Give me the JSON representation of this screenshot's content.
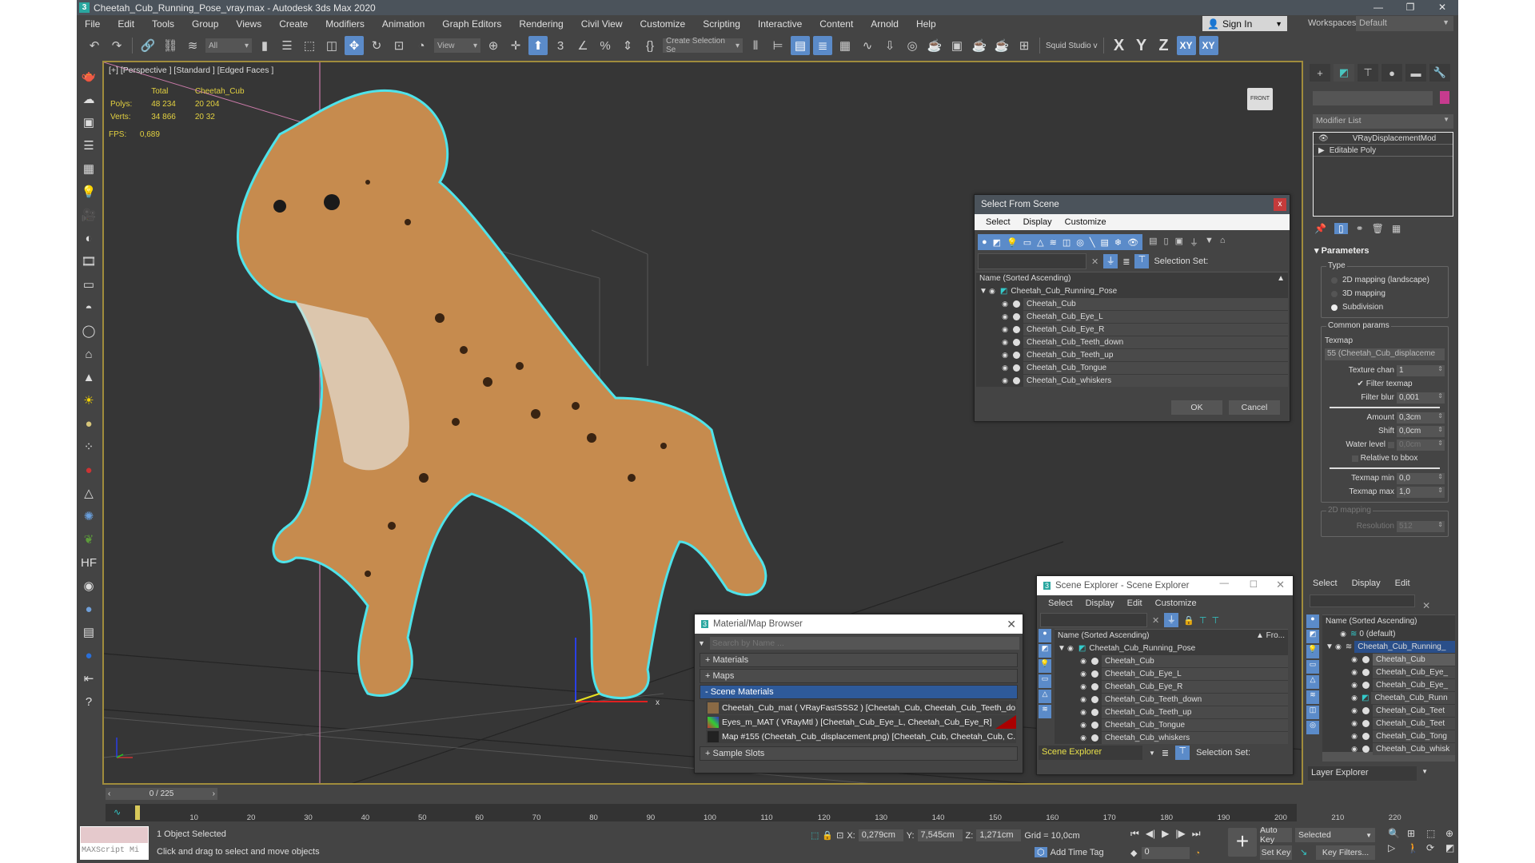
{
  "window": {
    "title": "Cheetah_Cub_Running_Pose_vray.max - Autodesk 3ds Max 2020",
    "app_icon": "3",
    "controls": [
      "minimize-icon",
      "maximize-icon",
      "close-icon"
    ]
  },
  "menu": [
    "File",
    "Edit",
    "Tools",
    "Group",
    "Views",
    "Create",
    "Modifiers",
    "Animation",
    "Graph Editors",
    "Rendering",
    "Civil View",
    "Customize",
    "Scripting",
    "Interactive",
    "Content",
    "Arnold",
    "Help"
  ],
  "account": {
    "sign_in": "Sign In",
    "workspaces_label": "Workspaces:",
    "workspace": "Default"
  },
  "toolbar": {
    "selection_filter": "All",
    "ref_coord": "View",
    "named_selection": "Create Selection Se",
    "studio": "Squid Studio v",
    "axis": [
      "X",
      "Y",
      "Z",
      "XY",
      "XY"
    ]
  },
  "viewport": {
    "label": "[+] [Perspective ] [Standard ] [Edged Faces ]",
    "stats": {
      "col_total": "Total",
      "col_object": "Cheetah_Cub",
      "polys_label": "Polys:",
      "polys_total": "48 234",
      "polys_object": "20 204",
      "verts_label": "Verts:",
      "verts_total": "34 866",
      "verts_object": "20 32"
    },
    "fps_label": "FPS:",
    "fps": "0,689",
    "viewcube": "FRONT",
    "gizmo_axis": "x"
  },
  "select_from_scene": {
    "title": "Select From Scene",
    "close": "x",
    "menu": [
      "Select",
      "Display",
      "Customize"
    ],
    "selection_set_label": "Selection Set:",
    "column": "Name (Sorted Ascending)",
    "root": "Cheetah_Cub_Running_Pose",
    "children": [
      "Cheetah_Cub",
      "Cheetah_Cub_Eye_L",
      "Cheetah_Cub_Eye_R",
      "Cheetah_Cub_Teeth_down",
      "Cheetah_Cub_Teeth_up",
      "Cheetah_Cub_Tongue",
      "Cheetah_Cub_whiskers"
    ],
    "ok": "OK",
    "cancel": "Cancel"
  },
  "material_browser": {
    "title": "Material/Map Browser",
    "search_placeholder": "Search by Name ...",
    "sections": {
      "materials": "+ Materials",
      "maps": "+ Maps",
      "scene": "- Scene Materials",
      "slots": "+ Sample Slots"
    },
    "items": [
      "Cheetah_Cub_mat  ( VRayFastSSS2 )  [Cheetah_Cub, Cheetah_Cub_Teeth_do...",
      "Eyes_m_MAT  ( VRayMtl )  [Cheetah_Cub_Eye_L, Cheetah_Cub_Eye_R]",
      "Map #155 (Cheetah_Cub_displacement.png)  [Cheetah_Cub, Cheetah_Cub, C..."
    ]
  },
  "scene_explorer_float": {
    "title": "Scene Explorer - Scene Explorer",
    "menu": [
      "Select",
      "Display",
      "Edit",
      "Customize"
    ],
    "column": "Name (Sorted Ascending)",
    "column2": "Fro...",
    "root": "Cheetah_Cub_Running_Pose",
    "children": [
      "Cheetah_Cub",
      "Cheetah_Cub_Eye_L",
      "Cheetah_Cub_Eye_R",
      "Cheetah_Cub_Teeth_down",
      "Cheetah_Cub_Teeth_up",
      "Cheetah_Cub_Tongue",
      "Cheetah_Cub_whiskers"
    ],
    "footer_name": "Scene Explorer",
    "selection_set_label": "Selection Set:"
  },
  "command_panel": {
    "modifier_list": "Modifier List",
    "stack": [
      "VRayDisplacementMod",
      "Editable Poly"
    ],
    "object_color": "#c63b8e",
    "parameters": {
      "title": "Parameters",
      "type_label": "Type",
      "types": [
        "2D mapping (landscape)",
        "3D mapping",
        "Subdivision"
      ],
      "selected_type": "Subdivision",
      "common_label": "Common params",
      "texmap_label": "Texmap",
      "texmap": "55 (Cheetah_Cub_displaceme",
      "texture_chan_label": "Texture chan",
      "texture_chan": "1",
      "filter_texmap": "Filter texmap",
      "filter_texmap_checked": true,
      "filter_blur_label": "Filter blur",
      "filter_blur": "0,001",
      "amount_label": "Amount",
      "amount": "0,3cm",
      "shift_label": "Shift",
      "shift": "0,0cm",
      "water_label": "Water level",
      "water": "0,0cm",
      "relative_bbox": "Relative to bbox",
      "texmap_min_label": "Texmap min",
      "texmap_min": "0,0",
      "texmap_max_label": "Texmap max",
      "texmap_max": "1,0",
      "mapping2d_label": "2D mapping",
      "resolution_label": "Resolution",
      "resolution": "512"
    }
  },
  "layer_explorer": {
    "menu": [
      "Select",
      "Display",
      "Edit"
    ],
    "column": "Name (Sorted Ascending)",
    "rows": [
      "0 (default)",
      "Cheetah_Cub_Running_",
      "Cheetah_Cub",
      "Cheetah_Cub_Eye_",
      "Cheetah_Cub_Eye_",
      "Cheetah_Cub_Runn",
      "Cheetah_Cub_Teet",
      "Cheetah_Cub_Teet",
      "Cheetah_Cub_Tong",
      "Cheetah_Cub_whisk"
    ],
    "footer": "Layer Explorer"
  },
  "timeline": {
    "frame": "0 / 225",
    "ticks": [
      "0",
      "10",
      "20",
      "30",
      "40",
      "50",
      "60",
      "70",
      "80",
      "90",
      "100",
      "110",
      "120",
      "130",
      "140",
      "150",
      "160",
      "170",
      "180",
      "190",
      "200",
      "210",
      "220"
    ],
    "current_frame": 0,
    "total_frames": 225
  },
  "status": {
    "maxscript": "MAXScript Mi",
    "selected": "1 Object Selected",
    "prompt": "Click and drag to select and move objects",
    "x_label": "X:",
    "x": "0,279cm",
    "y_label": "Y:",
    "y": "7,545cm",
    "z_label": "Z:",
    "z": "1,271cm",
    "grid": "Grid = 10,0cm",
    "add_time_tag": "Add Time Tag",
    "frame_input": "0",
    "auto_key": "Auto Key",
    "set_key": "Set Key",
    "key_mode": "Selected",
    "key_filters": "Key Filters..."
  }
}
